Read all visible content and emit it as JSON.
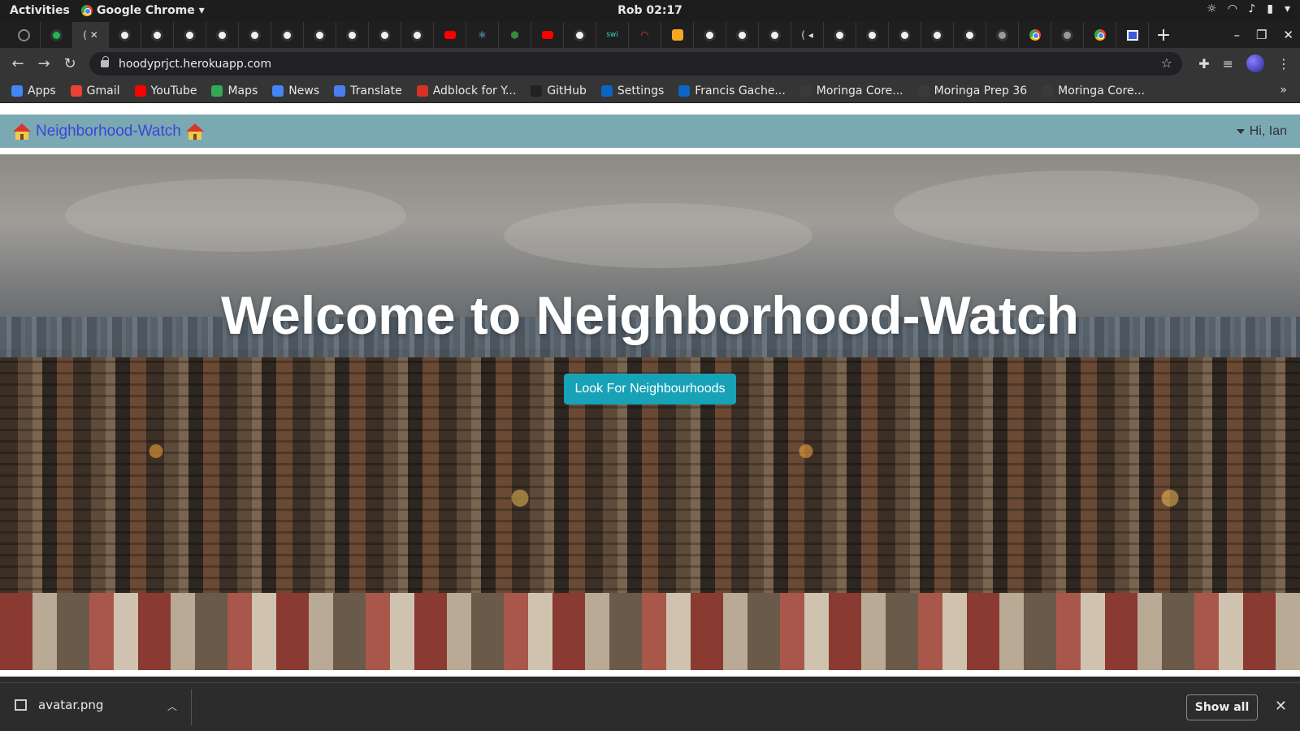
{
  "system": {
    "activities": "Activities",
    "app_name": "Google Chrome",
    "clock": "Rob 02:17"
  },
  "browser": {
    "url": "hoodyprjct.herokuapp.com",
    "tab_count": 36
  },
  "bookmarks": [
    {
      "label": "Apps",
      "color": "#4285f4"
    },
    {
      "label": "Gmail",
      "color": "#ea4335"
    },
    {
      "label": "YouTube",
      "color": "#ff0000"
    },
    {
      "label": "Maps",
      "color": "#34a853"
    },
    {
      "label": "News",
      "color": "#4285f4"
    },
    {
      "label": "Translate",
      "color": "#4a7ef0"
    },
    {
      "label": "Adblock for Y...",
      "color": "#d93025"
    },
    {
      "label": "GitHub",
      "color": "#222222"
    },
    {
      "label": "Settings",
      "color": "#0a66c2"
    },
    {
      "label": "Francis Gache...",
      "color": "#0a66c2"
    },
    {
      "label": "Moringa Core...",
      "color": "#3a3a3a"
    },
    {
      "label": "Moringa Prep 36",
      "color": "#3a3a3a"
    },
    {
      "label": "Moringa Core...",
      "color": "#3a3a3a"
    }
  ],
  "site": {
    "brand": "Neighborhood-Watch",
    "user_greeting": "Hi, Ian",
    "hero_title": "Welcome to Neighborhood-Watch",
    "cta_label": "Look For Neighbourhoods",
    "nav_color": "#7aa9b4",
    "cta_color": "#17a2b8"
  },
  "downloads": {
    "file_name": "avatar.png",
    "show_all_label": "Show all"
  }
}
